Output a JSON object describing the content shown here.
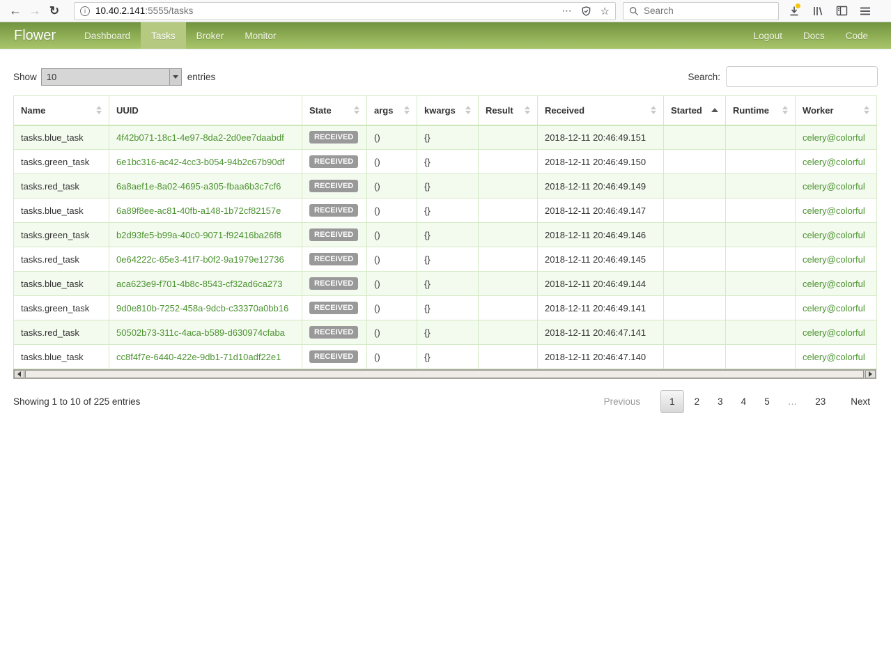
{
  "browser": {
    "url_host": "10.40.2.141",
    "url_path": ":5555/tasks",
    "search_placeholder": "Search",
    "icons": {
      "back": "←",
      "forward": "→",
      "refresh": "↻",
      "info": "i",
      "page_actions_dots": "⋯",
      "bookmark_star": "☆"
    }
  },
  "navbar": {
    "brand": "Flower",
    "items": [
      {
        "label": "Dashboard",
        "active": false
      },
      {
        "label": "Tasks",
        "active": true
      },
      {
        "label": "Broker",
        "active": false
      },
      {
        "label": "Monitor",
        "active": false
      }
    ],
    "right_items": [
      {
        "label": "Logout"
      },
      {
        "label": "Docs"
      },
      {
        "label": "Code"
      }
    ]
  },
  "controls": {
    "show_label": "Show",
    "page_size": "10",
    "entries_label": "entries",
    "search_label": "Search:",
    "search_value": ""
  },
  "table": {
    "columns": [
      {
        "label": "Name",
        "key": "name",
        "sort": "both"
      },
      {
        "label": "UUID",
        "key": "uuid",
        "sort": "none"
      },
      {
        "label": "State",
        "key": "state",
        "sort": "both"
      },
      {
        "label": "args",
        "key": "args",
        "sort": "both"
      },
      {
        "label": "kwargs",
        "key": "kwargs",
        "sort": "both"
      },
      {
        "label": "Result",
        "key": "result",
        "sort": "both"
      },
      {
        "label": "Received",
        "key": "received",
        "sort": "both"
      },
      {
        "label": "Started",
        "key": "started",
        "sort": "asc"
      },
      {
        "label": "Runtime",
        "key": "runtime",
        "sort": "both"
      },
      {
        "label": "Worker",
        "key": "worker",
        "sort": "both"
      }
    ],
    "rows": [
      {
        "name": "tasks.blue_task",
        "uuid": "4f42b071-18c1-4e97-8da2-2d0ee7daabdf",
        "state": "RECEIVED",
        "args": "()",
        "kwargs": "{}",
        "result": "",
        "received": "2018-12-11 20:46:49.151",
        "started": "",
        "runtime": "",
        "worker": "celery@colorful"
      },
      {
        "name": "tasks.green_task",
        "uuid": "6e1bc316-ac42-4cc3-b054-94b2c67b90df",
        "state": "RECEIVED",
        "args": "()",
        "kwargs": "{}",
        "result": "",
        "received": "2018-12-11 20:46:49.150",
        "started": "",
        "runtime": "",
        "worker": "celery@colorful"
      },
      {
        "name": "tasks.red_task",
        "uuid": "6a8aef1e-8a02-4695-a305-fbaa6b3c7cf6",
        "state": "RECEIVED",
        "args": "()",
        "kwargs": "{}",
        "result": "",
        "received": "2018-12-11 20:46:49.149",
        "started": "",
        "runtime": "",
        "worker": "celery@colorful"
      },
      {
        "name": "tasks.blue_task",
        "uuid": "6a89f8ee-ac81-40fb-a148-1b72cf82157e",
        "state": "RECEIVED",
        "args": "()",
        "kwargs": "{}",
        "result": "",
        "received": "2018-12-11 20:46:49.147",
        "started": "",
        "runtime": "",
        "worker": "celery@colorful"
      },
      {
        "name": "tasks.green_task",
        "uuid": "b2d93fe5-b99a-40c0-9071-f92416ba26f8",
        "state": "RECEIVED",
        "args": "()",
        "kwargs": "{}",
        "result": "",
        "received": "2018-12-11 20:46:49.146",
        "started": "",
        "runtime": "",
        "worker": "celery@colorful"
      },
      {
        "name": "tasks.red_task",
        "uuid": "0e64222c-65e3-41f7-b0f2-9a1979e12736",
        "state": "RECEIVED",
        "args": "()",
        "kwargs": "{}",
        "result": "",
        "received": "2018-12-11 20:46:49.145",
        "started": "",
        "runtime": "",
        "worker": "celery@colorful"
      },
      {
        "name": "tasks.blue_task",
        "uuid": "aca623e9-f701-4b8c-8543-cf32ad6ca273",
        "state": "RECEIVED",
        "args": "()",
        "kwargs": "{}",
        "result": "",
        "received": "2018-12-11 20:46:49.144",
        "started": "",
        "runtime": "",
        "worker": "celery@colorful"
      },
      {
        "name": "tasks.green_task",
        "uuid": "9d0e810b-7252-458a-9dcb-c33370a0bb16",
        "state": "RECEIVED",
        "args": "()",
        "kwargs": "{}",
        "result": "",
        "received": "2018-12-11 20:46:49.141",
        "started": "",
        "runtime": "",
        "worker": "celery@colorful"
      },
      {
        "name": "tasks.red_task",
        "uuid": "50502b73-311c-4aca-b589-d630974cfaba",
        "state": "RECEIVED",
        "args": "()",
        "kwargs": "{}",
        "result": "",
        "received": "2018-12-11 20:46:47.141",
        "started": "",
        "runtime": "",
        "worker": "celery@colorful"
      },
      {
        "name": "tasks.blue_task",
        "uuid": "cc8f4f7e-6440-422e-9db1-71d10adf22e1",
        "state": "RECEIVED",
        "args": "()",
        "kwargs": "{}",
        "result": "",
        "received": "2018-12-11 20:46:47.140",
        "started": "",
        "runtime": "",
        "worker": "celery@colorful"
      }
    ]
  },
  "footer": {
    "info": "Showing 1 to 10 of 225 entries",
    "pagination": {
      "previous": "Previous",
      "pages": [
        "1",
        "2",
        "3",
        "4",
        "5",
        "…",
        "23"
      ],
      "active_page": "1",
      "next": "Next"
    }
  },
  "colors": {
    "navbar_top": "#72943e",
    "navbar_bottom": "#a9c56b",
    "navbar_active": "#b5ca80",
    "link_green": "#4c9331",
    "table_border": "#d4eac4",
    "row_stripe": "#f3faee",
    "badge_gray": "#999999",
    "download_badge_yellow": "#f5c50e"
  }
}
